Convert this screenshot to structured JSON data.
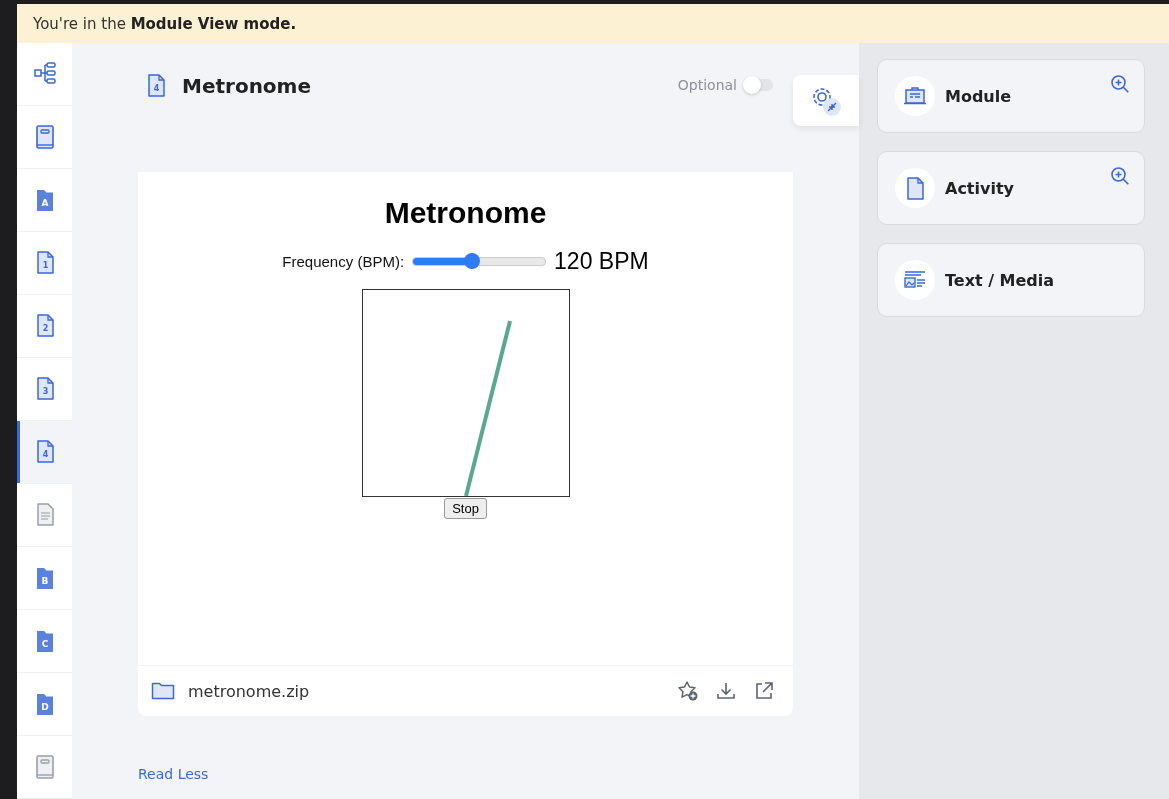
{
  "banner": {
    "text": "You're in the **Module View mode.**"
  },
  "sidebar": {
    "items": [
      {
        "kind": "tree",
        "selected": false,
        "disabled": false
      },
      {
        "kind": "book",
        "selected": false,
        "disabled": false
      },
      {
        "kind": "folder",
        "letter": "A",
        "selected": false,
        "disabled": false
      },
      {
        "kind": "page",
        "letter": "1",
        "selected": false,
        "disabled": false
      },
      {
        "kind": "page",
        "letter": "2",
        "selected": false,
        "disabled": false
      },
      {
        "kind": "page",
        "letter": "3",
        "selected": false,
        "disabled": false
      },
      {
        "kind": "page",
        "letter": "4",
        "selected": true,
        "disabled": false
      },
      {
        "kind": "document",
        "selected": false,
        "disabled": true
      },
      {
        "kind": "folder",
        "letter": "B",
        "selected": false,
        "disabled": false
      },
      {
        "kind": "folder",
        "letter": "C",
        "selected": false,
        "disabled": false
      },
      {
        "kind": "folder",
        "letter": "D",
        "selected": false,
        "disabled": false
      },
      {
        "kind": "book",
        "selected": false,
        "disabled": true
      }
    ]
  },
  "header": {
    "icon_letter": "4",
    "title": "Metronome",
    "optional": {
      "label": "Optional",
      "on": false
    }
  },
  "content": {
    "heading": "Metronome",
    "slider_label": "Frequency (BPM):",
    "slider": {
      "level": 0.45
    },
    "reading": "120 BPM",
    "button": "Stop"
  },
  "file": {
    "name": "metronome.zip"
  },
  "read_less": "Read Less",
  "panel": {
    "cards": [
      {
        "kind": "module",
        "label": "Module",
        "zoomable": true
      },
      {
        "kind": "activity",
        "label": "Activity",
        "zoomable": true
      },
      {
        "kind": "media",
        "label": "Text / Media",
        "zoomable": false
      }
    ]
  }
}
